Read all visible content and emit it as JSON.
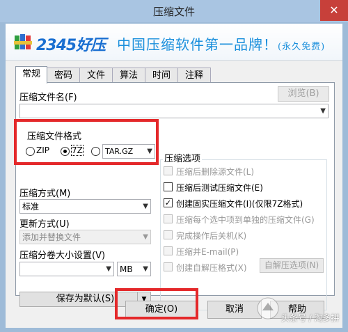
{
  "window": {
    "title": "压缩文件",
    "close_glyph": "✕"
  },
  "banner": {
    "logo": "2345好压",
    "slogan": "中国压缩软件第一品牌！",
    "slogan_suffix": "(永久免费)"
  },
  "tabs": [
    "常规",
    "密码",
    "文件",
    "算法",
    "时间",
    "注释"
  ],
  "general": {
    "archive_name_label": "压缩文件名(F)",
    "browse_button": "浏览(B)",
    "archive_name_value": "",
    "format_label": "压缩文件格式",
    "formats": [
      {
        "label": "ZIP",
        "selected": false
      },
      {
        "label": "7Z",
        "selected": true
      },
      {
        "label": "TAR.GZ",
        "selected": false
      }
    ],
    "method_label": "压缩方式(M)",
    "method_value": "标准",
    "update_label": "更新方式(U)",
    "update_value": "添加并替换文件",
    "split_label": "压缩分卷大小设置(V)",
    "split_value": "",
    "split_unit": "MB",
    "save_default_button": "保存为默认(S)",
    "options_label": "压缩选项",
    "options": [
      {
        "label": "压缩后删除源文件(L)",
        "checked": false,
        "enabled": false
      },
      {
        "label": "压缩后测试压缩文件(E)",
        "checked": false,
        "enabled": true
      },
      {
        "label": "创建固实压缩文件(I)(仅限7Z格式)",
        "checked": true,
        "enabled": true
      },
      {
        "label": "压缩每个选中项到单独的压缩文件(G)",
        "checked": false,
        "enabled": false
      },
      {
        "label": "完成操作后关机(K)",
        "checked": false,
        "enabled": false
      },
      {
        "label": "压缩并E-mail(P)",
        "checked": false,
        "enabled": false
      },
      {
        "label": "创建自解压格式(X)",
        "checked": false,
        "enabled": false
      }
    ],
    "sfx_options_button": "自解压选项(N)"
  },
  "footer": {
    "ok": "确定(O)",
    "cancel": "取消",
    "help": "帮助"
  },
  "watermark": "头条号 / 淘多拼",
  "colors": {
    "highlight": "#e4282a",
    "brand": "#1a6fd1"
  }
}
